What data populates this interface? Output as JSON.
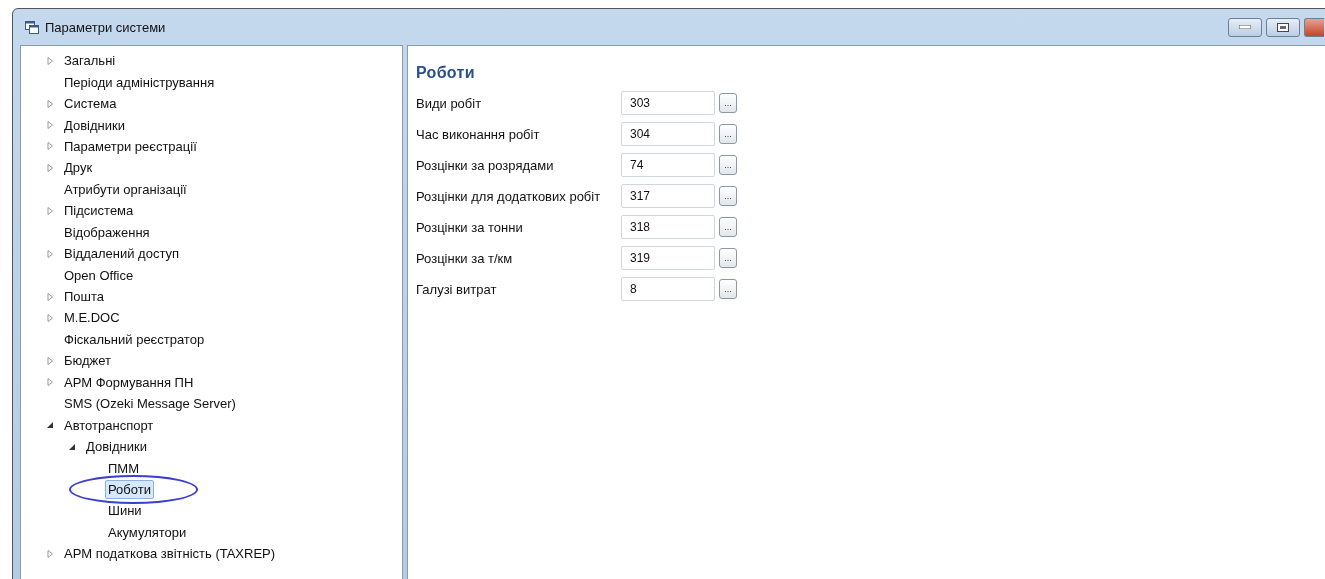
{
  "window": {
    "title": "Параметри системи"
  },
  "tree": [
    {
      "label": "Загальні",
      "kind": "branch",
      "expanded": false,
      "selected": false
    },
    {
      "label": "Періоди адміністрування",
      "kind": "leaf",
      "selected": false
    },
    {
      "label": "Система",
      "kind": "branch",
      "expanded": false,
      "selected": false
    },
    {
      "label": "Довідники",
      "kind": "branch",
      "expanded": false,
      "selected": false
    },
    {
      "label": "Параметри реєстрації",
      "kind": "branch",
      "expanded": false,
      "selected": false
    },
    {
      "label": "Друк",
      "kind": "branch",
      "expanded": false,
      "selected": false
    },
    {
      "label": "Атрибути організації",
      "kind": "leaf",
      "selected": false
    },
    {
      "label": "Підсистема",
      "kind": "branch",
      "expanded": false,
      "selected": false
    },
    {
      "label": "Відображення",
      "kind": "leaf",
      "selected": false
    },
    {
      "label": "Віддалений доступ",
      "kind": "branch",
      "expanded": false,
      "selected": false
    },
    {
      "label": "Open Office",
      "kind": "leaf",
      "selected": false
    },
    {
      "label": "Пошта",
      "kind": "branch",
      "expanded": false,
      "selected": false
    },
    {
      "label": "M.E.DOC",
      "kind": "branch",
      "expanded": false,
      "selected": false
    },
    {
      "label": "Фіскальний реєстратор",
      "kind": "leaf",
      "selected": false
    },
    {
      "label": "Бюджет",
      "kind": "branch",
      "expanded": false,
      "selected": false
    },
    {
      "label": "АРМ Формування ПН",
      "kind": "branch",
      "expanded": false,
      "selected": false
    },
    {
      "label": "SMS (Ozeki Message Server)",
      "kind": "leaf",
      "selected": false
    },
    {
      "label": "Автотранспорт",
      "kind": "branch",
      "expanded": true,
      "selected": false,
      "children": [
        {
          "label": "Довідники",
          "kind": "branch",
          "expanded": true,
          "selected": false,
          "children": [
            {
              "label": "ПММ",
              "kind": "leaf",
              "selected": false
            },
            {
              "label": "Роботи",
              "kind": "leaf",
              "selected": true
            },
            {
              "label": "Шини",
              "kind": "leaf",
              "selected": false
            },
            {
              "label": "Акумулятори",
              "kind": "leaf",
              "selected": false
            }
          ]
        }
      ]
    },
    {
      "label": "АРМ податкова звітність (TAXREP)",
      "kind": "branch",
      "expanded": false,
      "selected": false
    }
  ],
  "panel": {
    "title": "Роботи",
    "fields": [
      {
        "label": "Види робіт",
        "value": "303",
        "button": "..."
      },
      {
        "label": "Час виконання робіт",
        "value": "304",
        "button": "..."
      },
      {
        "label": "Розцінки за розрядами",
        "value": "74",
        "button": "..."
      },
      {
        "label": "Розцінки для додаткових робіт",
        "value": "317",
        "button": "..."
      },
      {
        "label": "Розцінки за тонни",
        "value": "318",
        "button": "..."
      },
      {
        "label": "Розцінки за т/км",
        "value": "319",
        "button": "..."
      },
      {
        "label": "Галузі витрат",
        "value": "8",
        "button": "..."
      }
    ]
  }
}
